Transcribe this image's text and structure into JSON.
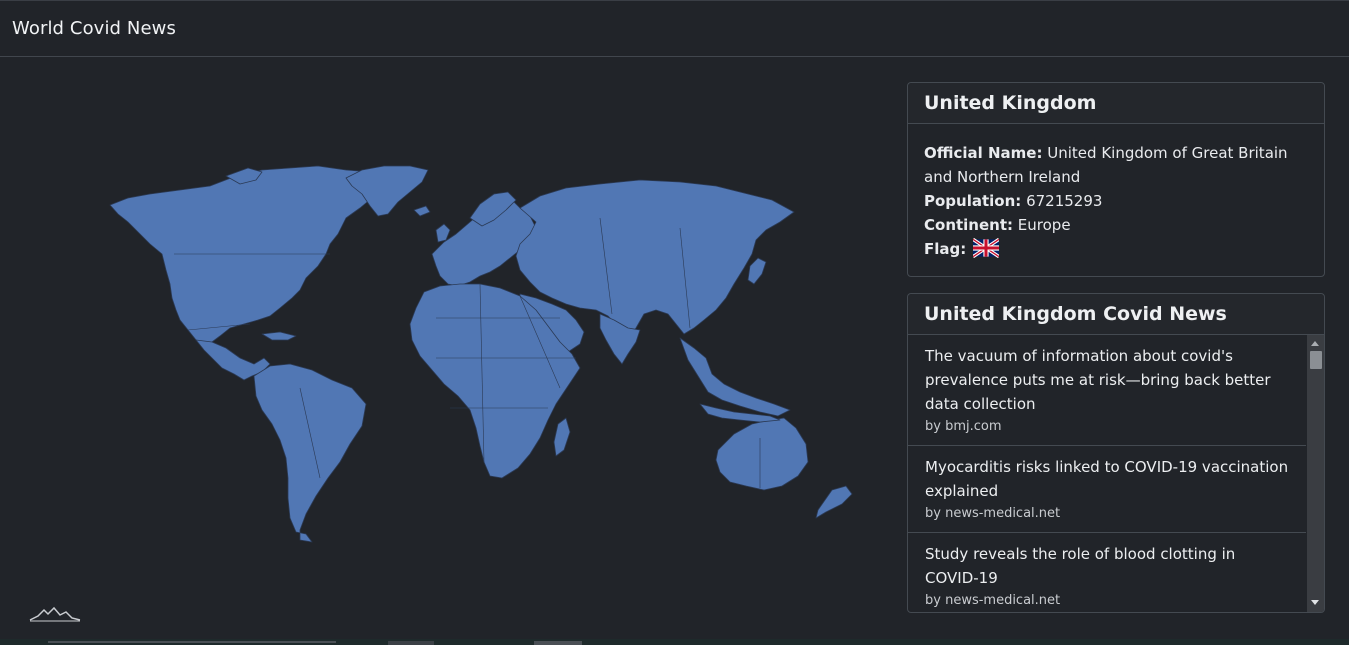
{
  "header": {
    "title": "World Covid News"
  },
  "map": {
    "land_color": "#5177b4",
    "border_color": "#2b3a55",
    "background": "#212429",
    "logo_icon": "mapbox-style-mountain-logo"
  },
  "country": {
    "name": "United Kingdom",
    "official_name_label": "Official Name:",
    "official_name": "United Kingdom of Great Britain and Northern Ireland",
    "population_label": "Population:",
    "population": "67215293",
    "continent_label": "Continent:",
    "continent": "Europe",
    "flag_label": "Flag:",
    "flag_icon": "uk-flag-icon"
  },
  "news": {
    "title": "United Kingdom Covid News",
    "items": [
      {
        "title": "The vacuum of information about covid's prevalence puts me at risk—bring back better data collection",
        "source": "by bmj.com"
      },
      {
        "title": "Myocarditis risks linked to COVID-19 vaccination explained",
        "source": "by news-medical.net"
      },
      {
        "title": "Study reveals the role of blood clotting in COVID-19",
        "source": "by news-medical.net"
      }
    ]
  },
  "colors": {
    "page_bg": "#212429",
    "border": "#444a51",
    "land": "#5177b4"
  }
}
